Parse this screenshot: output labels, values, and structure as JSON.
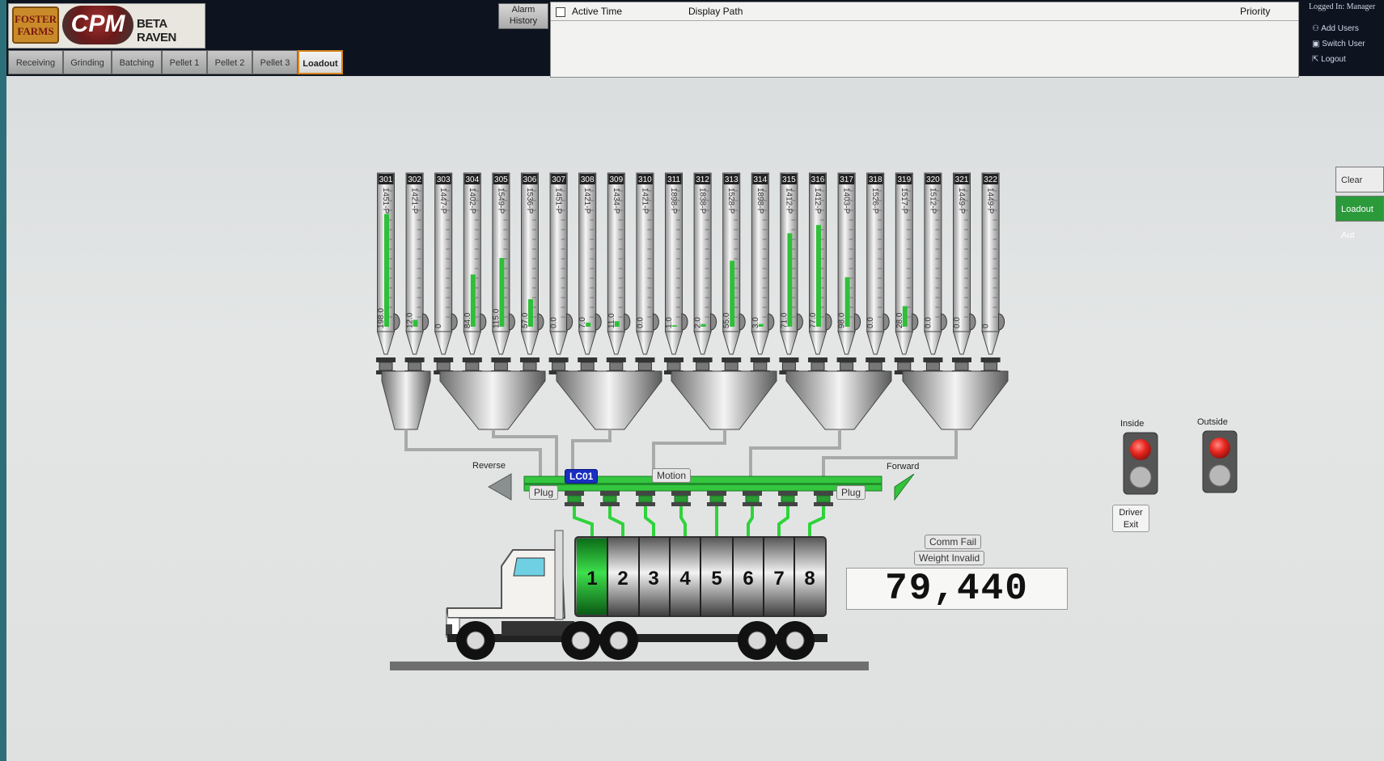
{
  "brand": {
    "foster": "FOSTER FARMS",
    "cpm": "CPM",
    "beta": "BETA RAVEN"
  },
  "tabs": [
    "Receiving",
    "Grinding",
    "Batching",
    "Pellet 1",
    "Pellet 2",
    "Pellet 3",
    "Loadout"
  ],
  "active_tab": "Loadout",
  "alarm_history_button": "Alarm History",
  "alarm_table": {
    "columns": [
      "Active Time",
      "Display Path",
      "Priority"
    ]
  },
  "user": {
    "logged_in": "Logged In: Manager",
    "add_users": "Add Users",
    "switch_user": "Switch User",
    "logout": "Logout"
  },
  "side_buttons": {
    "clear_alarm": "Clear Alarm",
    "loadout_auto": "Loadout Aut"
  },
  "silos": [
    {
      "id": "301",
      "label": "1451-P",
      "level": "198.0",
      "fill": 0.82
    },
    {
      "id": "302",
      "label": "1421-P",
      "level": "12.0",
      "fill": 0.05
    },
    {
      "id": "303",
      "label": "1447-P",
      "level": "0",
      "fill": 0.0
    },
    {
      "id": "304",
      "label": "1402-P",
      "level": "84.0",
      "fill": 0.38
    },
    {
      "id": "305",
      "label": "1549-P",
      "level": "115.0",
      "fill": 0.5
    },
    {
      "id": "306",
      "label": "1536-P",
      "level": "57.0",
      "fill": 0.2
    },
    {
      "id": "307",
      "label": "1451-P",
      "level": "0.0",
      "fill": 0.0
    },
    {
      "id": "308",
      "label": "1421-P",
      "level": "7.0",
      "fill": 0.03
    },
    {
      "id": "309",
      "label": "1434-P",
      "level": "11.0",
      "fill": 0.04
    },
    {
      "id": "310",
      "label": "1421-P",
      "level": "0.0",
      "fill": 0.0
    },
    {
      "id": "311",
      "label": "1898-P",
      "level": "1.0",
      "fill": 0.01
    },
    {
      "id": "312",
      "label": "1838-P",
      "level": "2.0",
      "fill": 0.02
    },
    {
      "id": "313",
      "label": "1528-P",
      "level": "55.0",
      "fill": 0.48
    },
    {
      "id": "314",
      "label": "1898-P",
      "level": "3.0",
      "fill": 0.02
    },
    {
      "id": "315",
      "label": "1412-P",
      "level": "71.0",
      "fill": 0.68
    },
    {
      "id": "316",
      "label": "1412-P",
      "level": "77.0",
      "fill": 0.74
    },
    {
      "id": "317",
      "label": "1403-P",
      "level": "98.0",
      "fill": 0.36
    },
    {
      "id": "318",
      "label": "1526-P",
      "level": "0.0",
      "fill": 0.0
    },
    {
      "id": "319",
      "label": "1517-P",
      "level": "28.0",
      "fill": 0.15
    },
    {
      "id": "320",
      "label": "1512-P",
      "level": "0.0",
      "fill": 0.0
    },
    {
      "id": "321",
      "label": "1449-P",
      "level": "0.0",
      "fill": 0.0
    },
    {
      "id": "322",
      "label": "1449-P",
      "level": "0",
      "fill": 0.0
    }
  ],
  "conveyor": {
    "id": "LC01",
    "motion": "Motion",
    "plug_left": "Plug",
    "plug_right": "Plug",
    "reverse": "Reverse",
    "forward": "Forward"
  },
  "compartments": [
    "1",
    "2",
    "3",
    "4",
    "5",
    "6",
    "7",
    "8"
  ],
  "active_compartment": "1",
  "status": {
    "comm_fail": "Comm Fail",
    "weight_invalid": "Weight Invalid"
  },
  "scale_weight": "79,440",
  "lights": {
    "inside": "Inside",
    "outside": "Outside",
    "driver_exit": "Driver Exit"
  },
  "colors": {
    "fill_green": "#2fbf3a",
    "accent_orange": "#d7851c",
    "light_red": "#e8261f"
  }
}
